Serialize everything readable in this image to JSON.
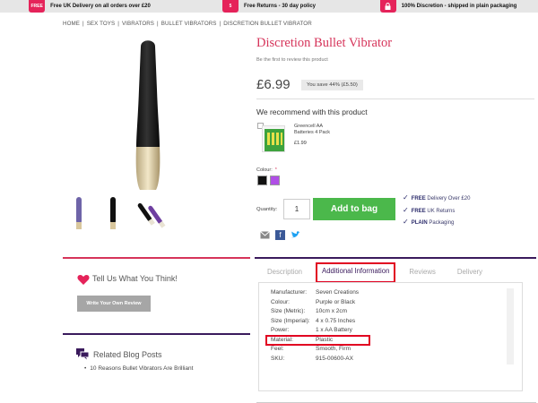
{
  "promo": [
    {
      "badge": "FREE",
      "text": "Free UK Delivery on all orders over £20"
    },
    {
      "badge": "5",
      "text": "Free Returns - 30 day policy"
    },
    {
      "badge": "",
      "text": "100% Discretion - shipped in plain packaging"
    }
  ],
  "breadcrumb": [
    "HOME",
    "SEX TOYS",
    "VIBRATORS",
    "BULLET VIBRATORS",
    "DISCRETION BULLET VIBRATOR"
  ],
  "product": {
    "title": "Discretion Bullet Vibrator",
    "review_link": "Be the first to review this product",
    "price": "£6.99",
    "save": "You save 44% (£5.50)",
    "colour_label": "Colour:",
    "colour_required": "*",
    "colours": [
      "#111111",
      "#b04fe6"
    ],
    "qty_label": "Quantity:",
    "qty": "1",
    "add_to_bag": "Add to bag"
  },
  "recommend": {
    "heading": "We recommend with this product",
    "name": "Greencell AA Batteries 4 Pack",
    "price": "£1.99"
  },
  "perks": [
    {
      "bold": "FREE",
      "text": " Delivery Over £20"
    },
    {
      "bold": "FREE",
      "text": " UK Returns"
    },
    {
      "bold": "PLAIN",
      "text": " Packaging"
    }
  ],
  "tabs": [
    "Description",
    "Additional Information",
    "Reviews",
    "Delivery"
  ],
  "specs": [
    {
      "k": "Manufacturer:",
      "v": "Seven Creations"
    },
    {
      "k": "Colour:",
      "v": "Purple or Black"
    },
    {
      "k": "Size (Metric):",
      "v": "10cm x 2cm"
    },
    {
      "k": "Size (Imperial):",
      "v": "4 x 0.75 Inches"
    },
    {
      "k": "Power:",
      "v": "1 x AA Battery"
    },
    {
      "k": "Material:",
      "v": "Plastic"
    },
    {
      "k": "Feel:",
      "v": "Smooth, Firm"
    },
    {
      "k": "SKU:",
      "v": "915-00600-AX"
    }
  ],
  "feedback": {
    "title": "Tell Us What You Think!",
    "button": "Write Your Own Review"
  },
  "blog": {
    "title": "Related Blog Posts",
    "item": "10 Reasons Bullet Vibrators Are Brilliant"
  },
  "colors": {
    "accent": "#d6345a",
    "purple": "#3a1a5c",
    "green": "#4bb84b",
    "highlight": "#e10021"
  }
}
